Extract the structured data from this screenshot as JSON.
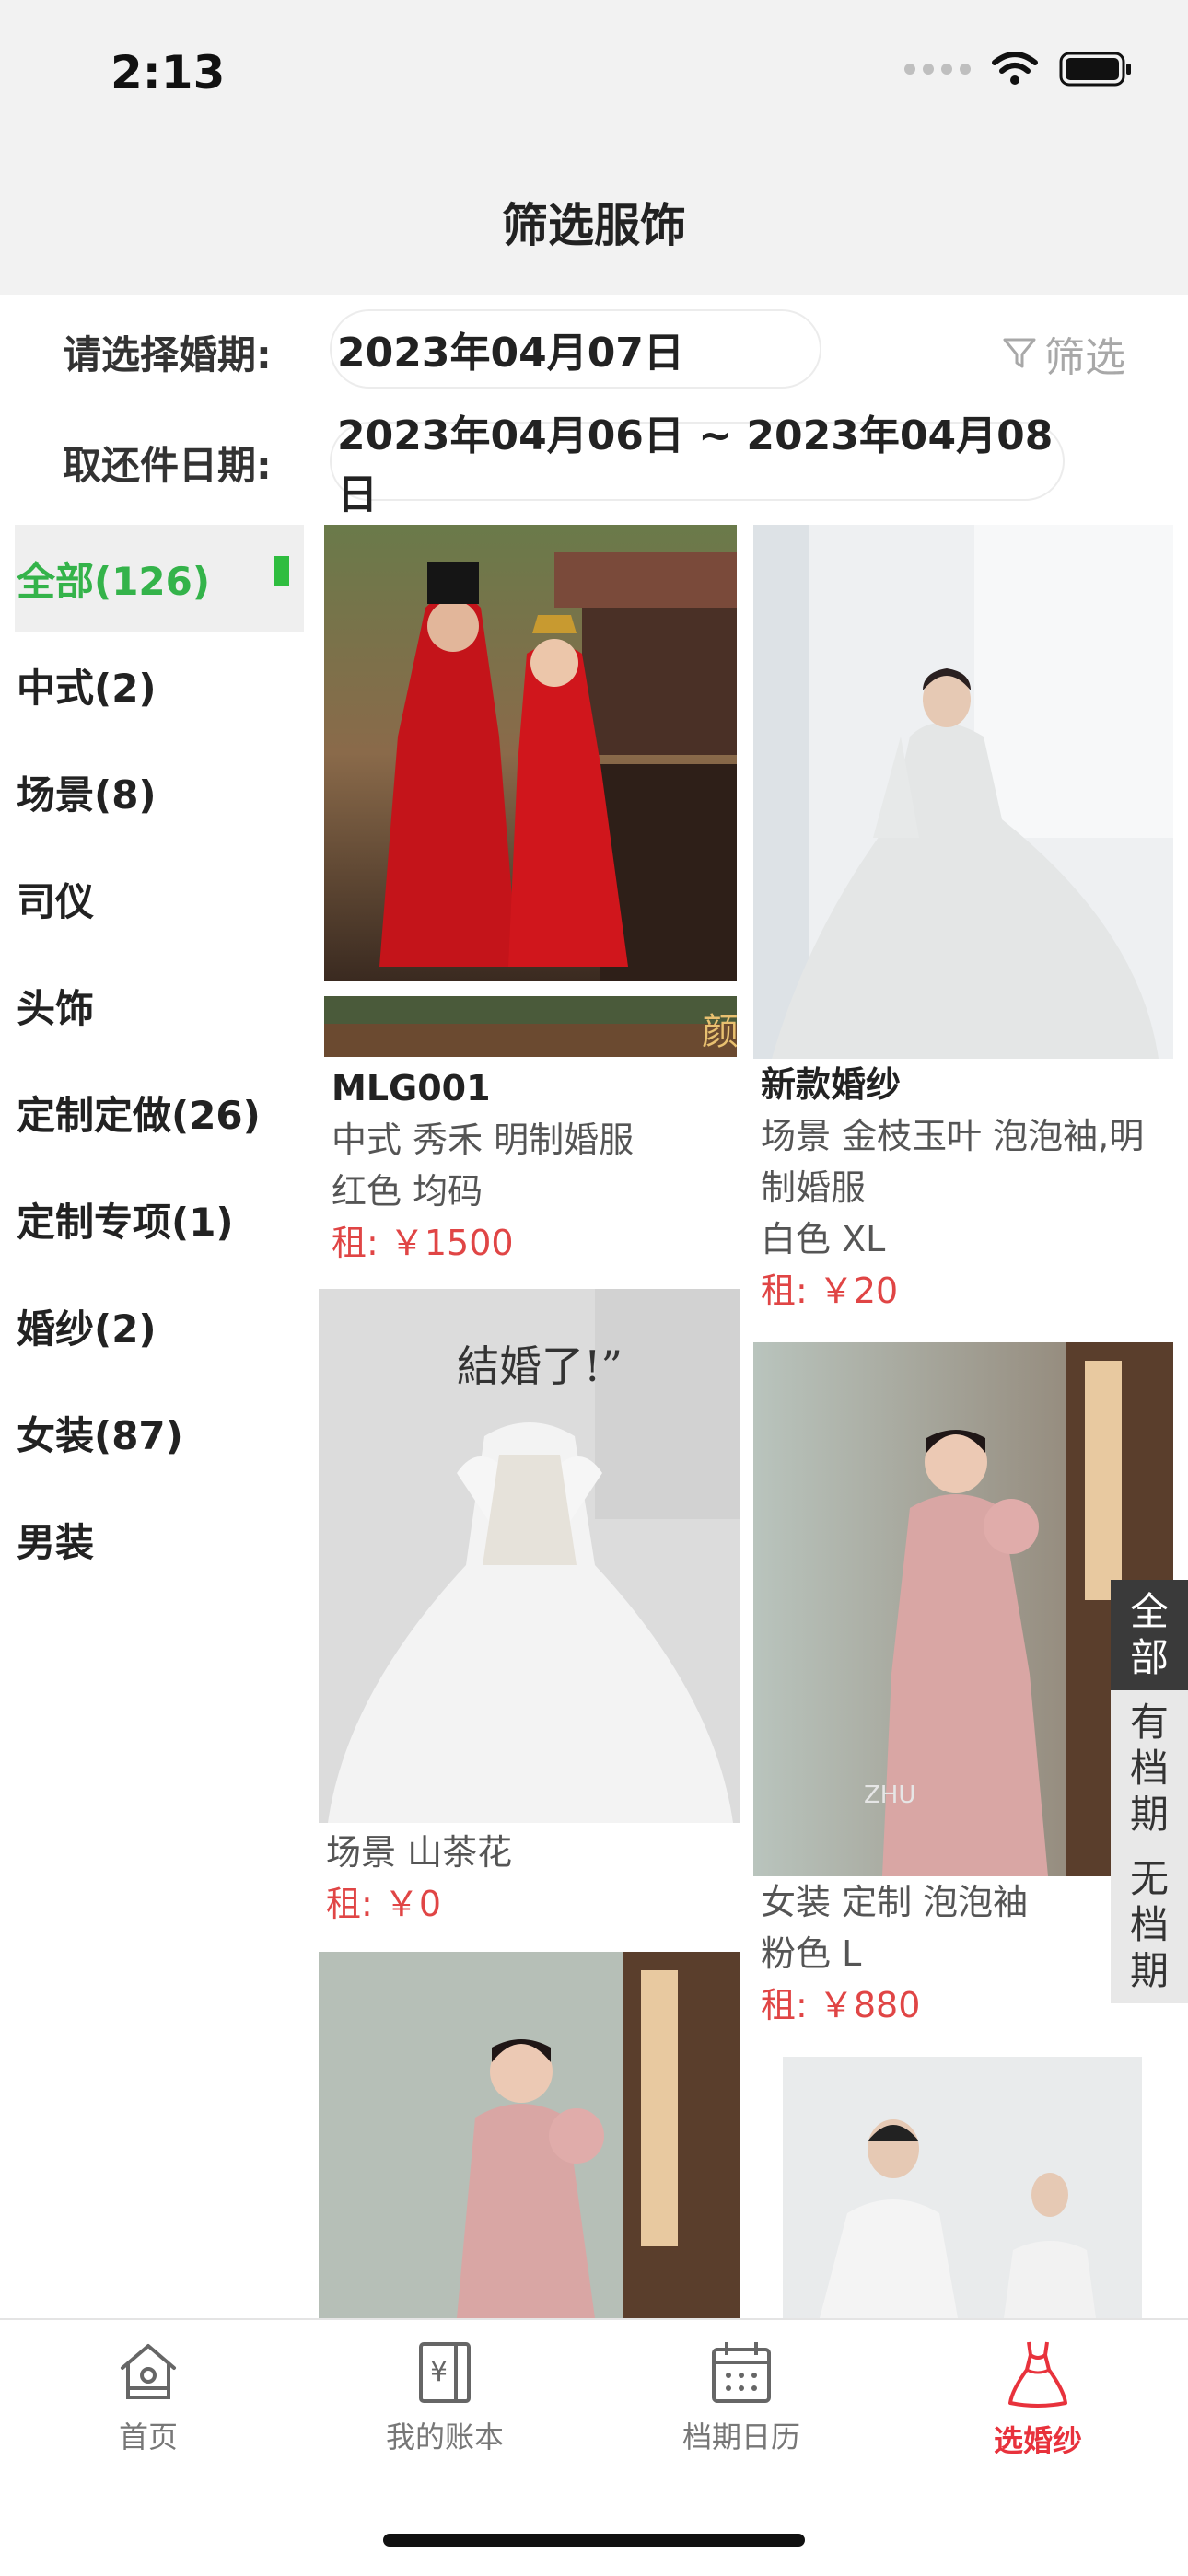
{
  "status_bar": {
    "time": "2:13"
  },
  "nav": {
    "title": "筛选服饰"
  },
  "filters": {
    "wedding_label": "请选择婚期:",
    "wedding_date": "2023年04月07日",
    "filter_button": "筛选",
    "pickup_label": "取还件日期:",
    "pickup_range": "2023年04月06日 ~ 2023年04月08日"
  },
  "categories": [
    {
      "label": "全部(126)"
    },
    {
      "label": "中式(2)"
    },
    {
      "label": "场景(8)"
    },
    {
      "label": "司仪"
    },
    {
      "label": "头饰"
    },
    {
      "label": "定制定做(26)"
    },
    {
      "label": "定制专项(1)"
    },
    {
      "label": "婚纱(2)"
    },
    {
      "label": "女装(87)"
    },
    {
      "label": "男装"
    }
  ],
  "products": [
    {
      "title": "MLG001",
      "desc": "中式 秀禾 明制婚服",
      "spec": "红色 均码",
      "price": "租: ￥1500"
    },
    {
      "title": "新款婚纱",
      "desc1": "场景 金枝玉叶 泡泡袖,明",
      "desc2": "制婚服",
      "spec": "白色 XL",
      "price": "租: ￥20"
    },
    {
      "desc": "场景 山茶花",
      "price": "租: ￥0"
    },
    {
      "desc": "女装 定制 泡泡袖",
      "spec": "粉色 L",
      "price": "租: ￥880"
    }
  ],
  "photo_text": {
    "p3_caption": "結婚了!”",
    "p4_watermark": "ZHU",
    "p1_seal": "颜"
  },
  "availability_tabs": [
    {
      "label": "全部"
    },
    {
      "label": "有档期"
    },
    {
      "label": "无档期"
    }
  ],
  "tabbar": [
    {
      "label": "首页",
      "icon": "home-icon"
    },
    {
      "label": "我的账本",
      "icon": "ledger-icon"
    },
    {
      "label": "档期日历",
      "icon": "calendar-icon"
    },
    {
      "label": "选婚纱",
      "icon": "dress-icon"
    }
  ],
  "colors": {
    "accent_green": "#34b34a",
    "price_red": "#e04545",
    "tab_active_red": "#e8323c"
  }
}
